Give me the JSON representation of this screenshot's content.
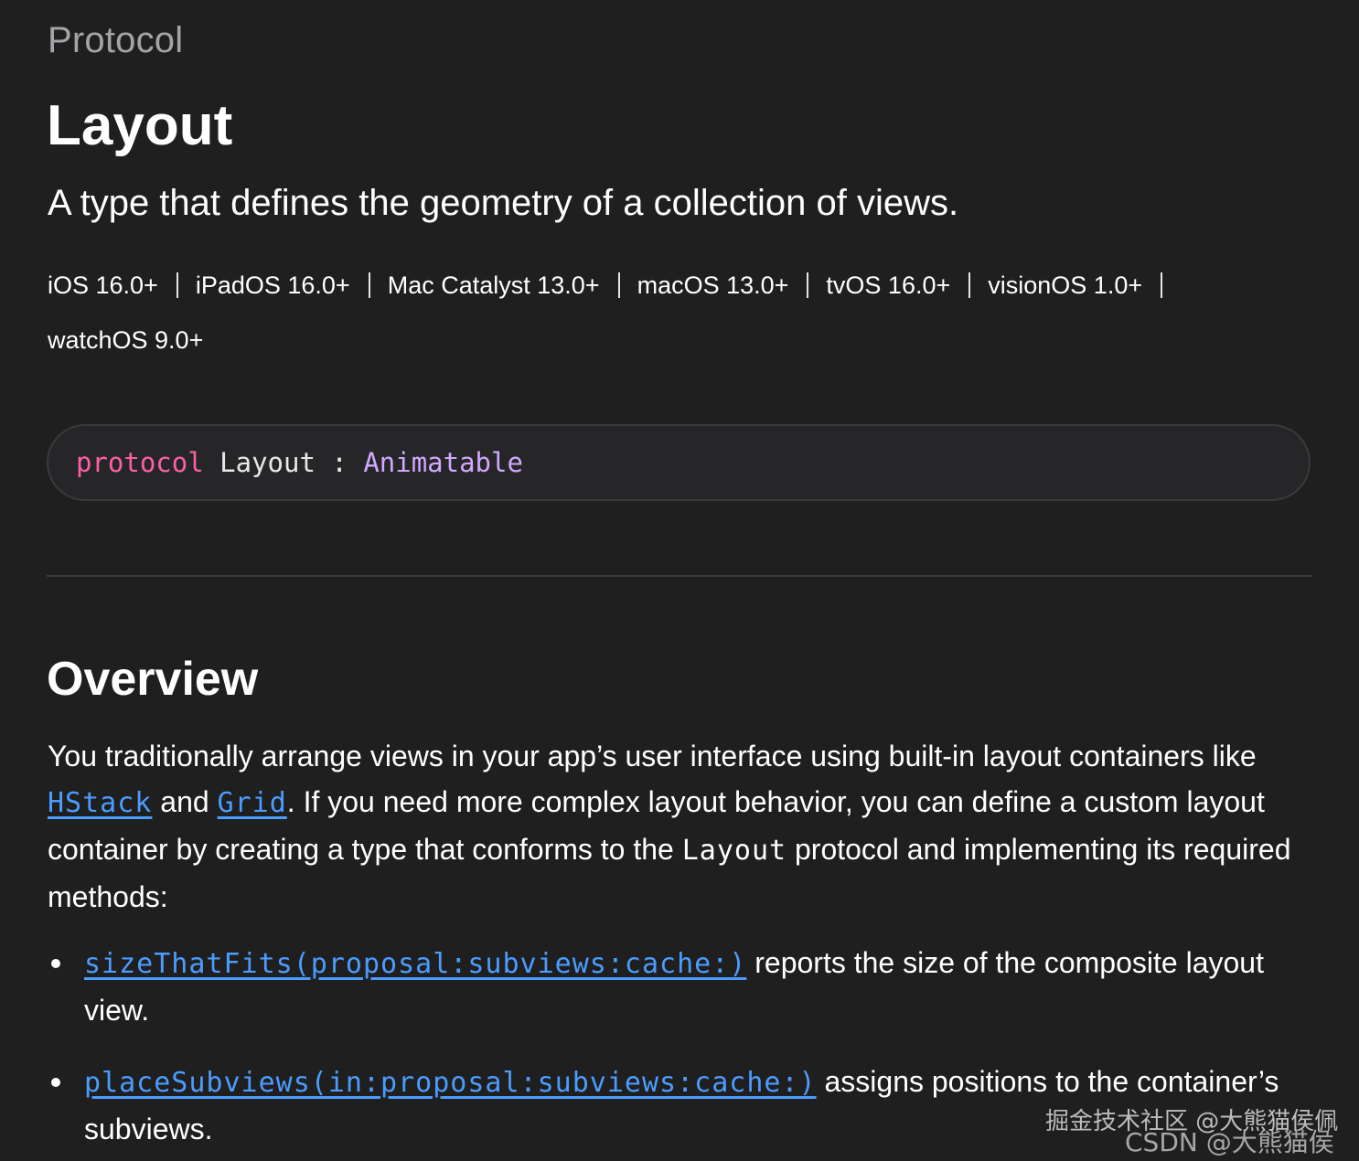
{
  "header": {
    "eyebrow": "Protocol",
    "title": "Layout",
    "abstract": "A type that defines the geometry of a collection of views."
  },
  "platforms": [
    "iOS 16.0+",
    "iPadOS 16.0+",
    "Mac Catalyst 13.0+",
    "macOS 13.0+",
    "tvOS 16.0+",
    "visionOS 1.0+",
    "watchOS 9.0+"
  ],
  "declaration": {
    "keyword": "protocol",
    "name": "Layout",
    "colon": ":",
    "conforms_to": "Animatable"
  },
  "overview": {
    "heading": "Overview",
    "p1_a": "You traditionally arrange views in your app’s user interface using built-in layout containers like ",
    "link_hstack": "HStack",
    "p1_b": " and ",
    "link_grid": "Grid",
    "p1_c": ". If you need more complex layout behavior, you can define a custom layout container by creating a type that conforms to the ",
    "code_layout": "Layout",
    "p1_d": " protocol and implementing its required methods:",
    "bullets": [
      {
        "link": "sizeThatFits(proposal:subviews:cache:)",
        "text": " reports the size of the composite layout view."
      },
      {
        "link": "placeSubviews(in:proposal:subviews:cache:)",
        "text": " assigns positions to the container’s subviews."
      }
    ]
  },
  "watermark": {
    "line1": "掘金技术社区 @大熊猫侯佩",
    "line2": "CSDN @大熊猫侯佩"
  },
  "colors": {
    "background": "#1f1f1f",
    "link": "#4b9cff",
    "keyword": "#fc5fa3",
    "type": "#d0a8ff",
    "eyebrow": "#a4a4a8"
  }
}
